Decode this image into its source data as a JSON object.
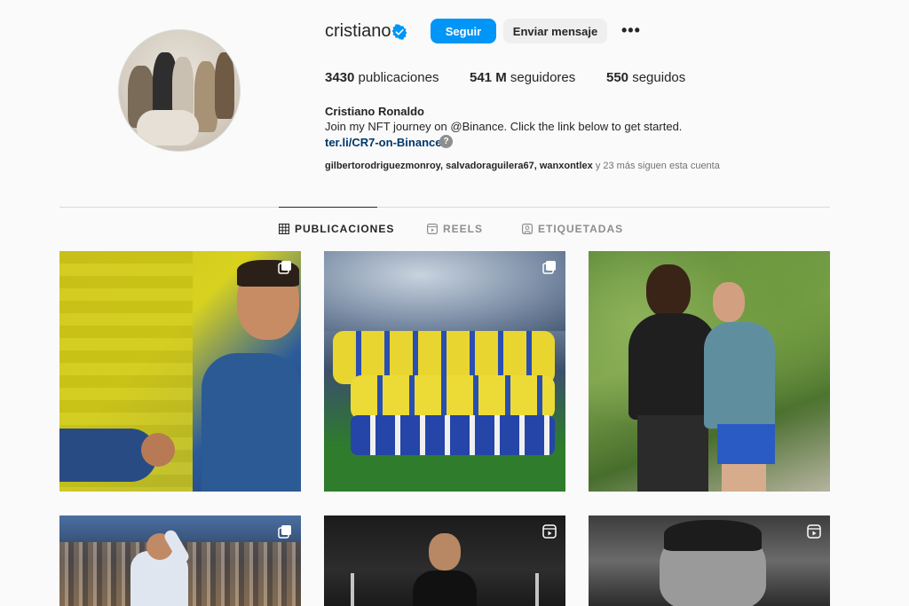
{
  "profile": {
    "username": "cristiano",
    "follow_label": "Seguir",
    "message_label": "Enviar mensaje",
    "more_label": "•••",
    "stats": {
      "posts_count": "3430",
      "posts_label": "publicaciones",
      "followers_count": "541 M",
      "followers_label": "seguidores",
      "following_count": "550",
      "following_label": "seguidos"
    },
    "full_name": "Cristiano Ronaldo",
    "bio": "Join my NFT journey on @Binance. Click the link below to get started.",
    "link": "ter.li/CR7-on-Binance",
    "followed_by_users": "gilbertorodriguezmonroy, salvadoraguilera67, wanxontlex",
    "followed_by_suffix": " y 23 más siguen esta cuenta"
  },
  "tabs": [
    {
      "label": "PUBLICACIONES",
      "icon": "grid-icon",
      "active": true
    },
    {
      "label": "REELS",
      "icon": "reels-icon",
      "active": false
    },
    {
      "label": "ETIQUETADAS",
      "icon": "tagged-icon",
      "active": false
    }
  ],
  "posts": [
    {
      "type": "carousel"
    },
    {
      "type": "carousel"
    },
    {
      "type": "image"
    },
    {
      "type": "carousel"
    },
    {
      "type": "reel"
    },
    {
      "type": "reel"
    }
  ],
  "colors": {
    "accent": "#0095f6",
    "link": "#00376b",
    "verified": "#0095f6"
  }
}
